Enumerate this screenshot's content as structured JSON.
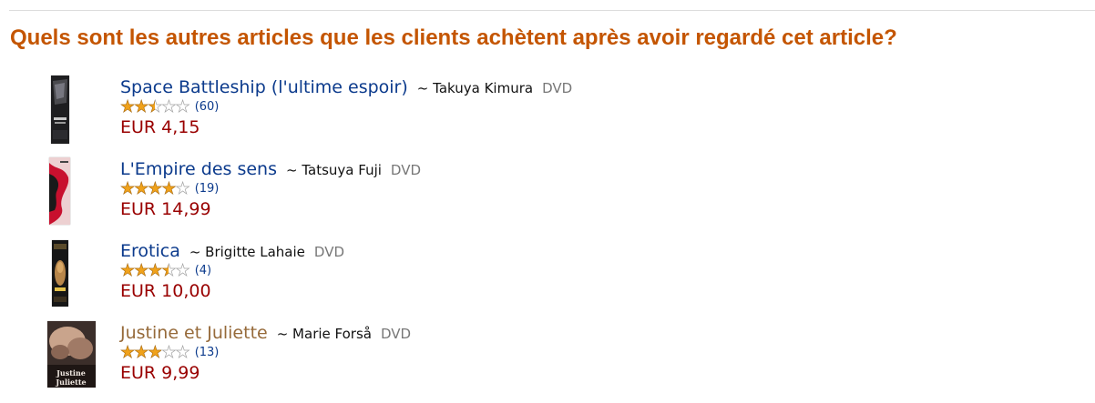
{
  "heading": "Quels sont les autres articles que les clients achètent après avoir regardé cet article?",
  "colors": {
    "heading": "#c45500",
    "link": "#0b3a8c",
    "visited_link": "#966a3a",
    "price": "#990000",
    "star": "#f0a21b"
  },
  "items": [
    {
      "title": "Space Battleship (l'ultime espoir)",
      "author": "~ Takuya Kimura",
      "format": "DVD",
      "rating": 2.5,
      "reviews": "(60)",
      "price": "EUR 4,15",
      "cover_icon": "dvd-cover-icon"
    },
    {
      "title": "L'Empire des sens",
      "author": "~ Tatsuya Fuji",
      "format": "DVD",
      "rating": 4.0,
      "reviews": "(19)",
      "price": "EUR 14,99",
      "cover_icon": "dvd-cover-icon"
    },
    {
      "title": "Erotica",
      "author": "~ Brigitte Lahaie",
      "format": "DVD",
      "rating": 3.5,
      "reviews": "(4)",
      "price": "EUR 10,00",
      "cover_icon": "dvd-cover-icon"
    },
    {
      "title": "Justine et Juliette",
      "author": "~ Marie Forså",
      "format": "DVD",
      "rating": 3.0,
      "reviews": "(13)",
      "price": "EUR 9,99",
      "cover_icon": "dvd-cover-icon"
    }
  ]
}
